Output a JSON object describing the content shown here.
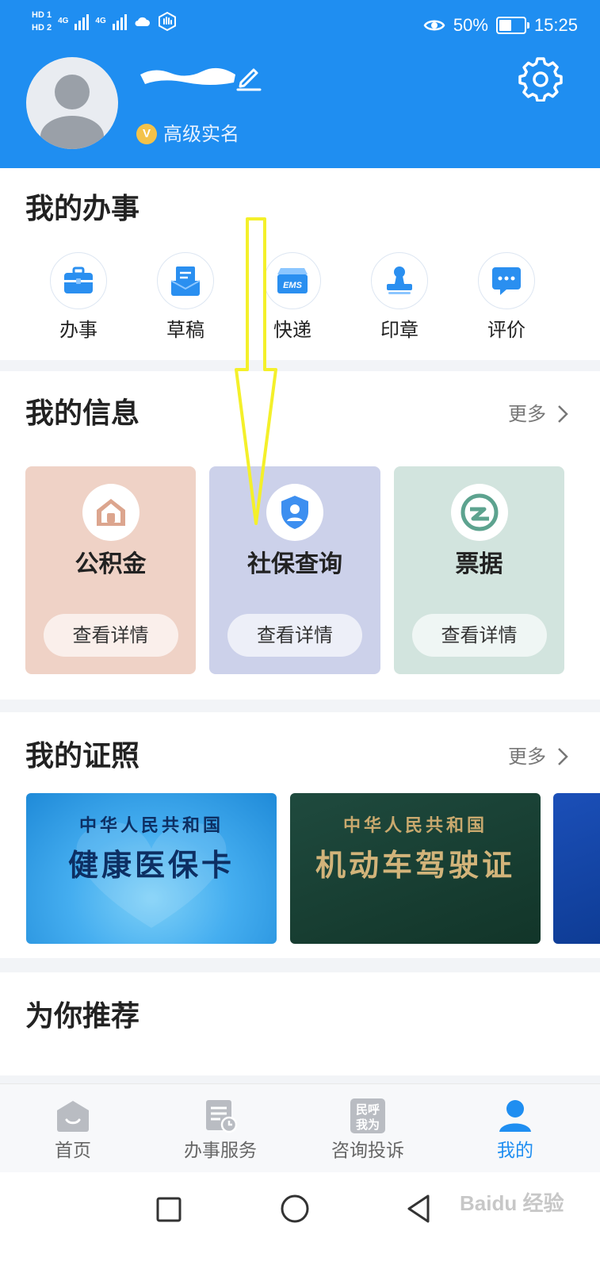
{
  "status_bar": {
    "hd1": "HD 1",
    "hd2": "HD 2",
    "net1": "4G",
    "net2": "4G",
    "battery": "50%",
    "time": "15:25",
    "battery_level": 0.5
  },
  "profile": {
    "verification": "高级实名",
    "verify_badge": "V"
  },
  "affairs": {
    "title": "我的办事",
    "items": [
      {
        "label": "办事",
        "icon": "briefcase-icon"
      },
      {
        "label": "草稿",
        "icon": "draft-icon"
      },
      {
        "label": "快递",
        "icon": "ems-box-icon",
        "icon_text": "EMS"
      },
      {
        "label": "印章",
        "icon": "stamp-icon"
      },
      {
        "label": "评价",
        "icon": "chat-bubble-icon"
      }
    ]
  },
  "info": {
    "title": "我的信息",
    "more": "更多",
    "cards": [
      {
        "title": "公积金",
        "button": "查看详情",
        "icon": "house-icon",
        "bg": "#efd2c6"
      },
      {
        "title": "社保查询",
        "button": "查看详情",
        "icon": "shield-user-icon",
        "bg": "#ccd1ea"
      },
      {
        "title": "票据",
        "button": "查看详情",
        "icon": "receipt-logo-icon",
        "bg": "#d2e4de"
      }
    ]
  },
  "licenses": {
    "title": "我的证照",
    "more": "更多",
    "items": [
      {
        "small": "中华人民共和国",
        "big": "健康医保卡"
      },
      {
        "small": "中华人民共和国",
        "big": "机动车驾驶证"
      }
    ]
  },
  "recommend": {
    "title": "为你推荐"
  },
  "bottom_nav": [
    {
      "label": "首页",
      "icon": "home-icon"
    },
    {
      "label": "办事服务",
      "icon": "service-doc-icon"
    },
    {
      "label": "咨询投诉",
      "icon": "complaint-icon",
      "icon_text_top": "民呼",
      "icon_text_bottom": "我为"
    },
    {
      "label": "我的",
      "icon": "profile-icon"
    }
  ],
  "watermark": "Baidu 经验",
  "colors": {
    "brand": "#1f8ef1",
    "annotation_arrow": "#f4f02a"
  }
}
